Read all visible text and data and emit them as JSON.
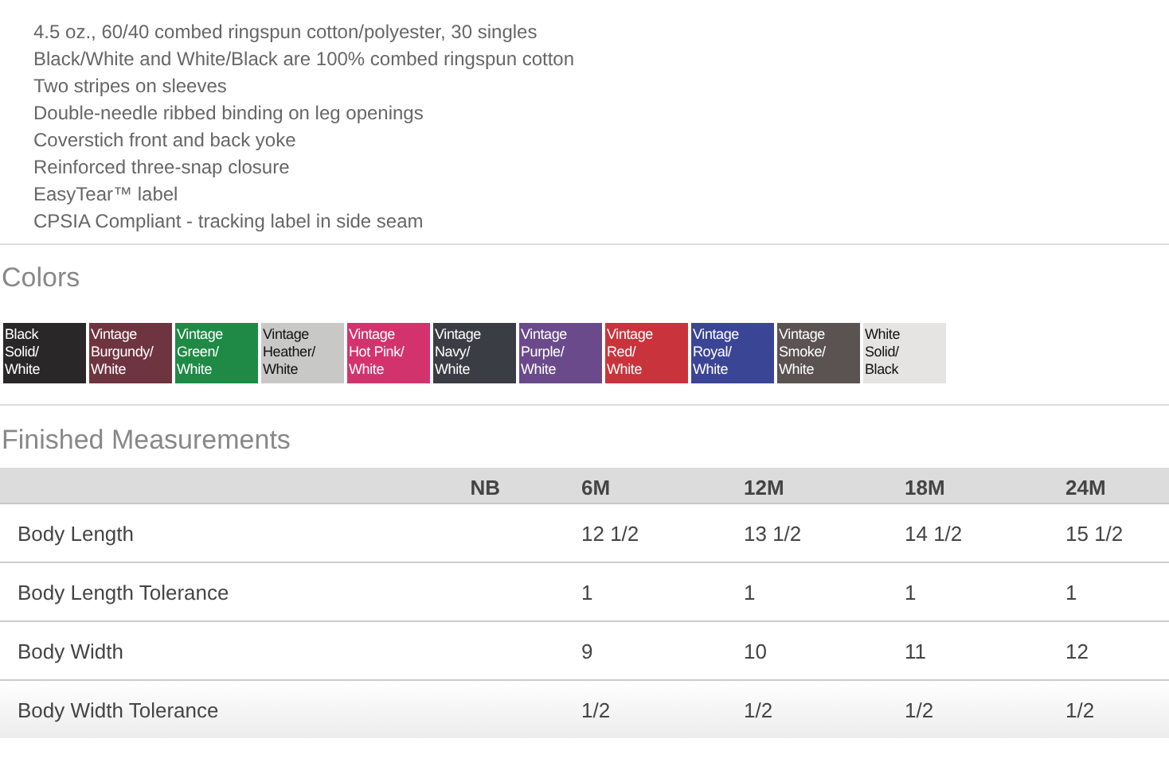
{
  "features": [
    "4.5 oz., 60/40 combed ringspun cotton/polyester, 30 singles",
    "Black/White and White/Black are 100% combed ringspun cotton",
    "Two stripes on sleeves",
    "Double-needle ribbed binding on leg openings",
    "Coverstich front and back yoke",
    "Reinforced three-snap closure",
    "EasyTear™ label",
    "CPSIA Compliant - tracking label in side seam"
  ],
  "colors": {
    "title": "Colors",
    "swatches": [
      {
        "label": "Black\nSolid/\nWhite",
        "color": "#2a2728"
      },
      {
        "label": "Vintage\nBurgundy/\nWhite",
        "color": "#6e3440"
      },
      {
        "label": "Vintage\nGreen/\nWhite",
        "color": "#1f8a45"
      },
      {
        "label": "Vintage\nHeather/\nWhite",
        "color": "#c8c8c6"
      },
      {
        "label": "Vintage\nHot Pink/\nWhite",
        "color": "#d3336d"
      },
      {
        "label": "Vintage\nNavy/\nWhite",
        "color": "#3b3d45"
      },
      {
        "label": "Vintage\nPurple/\nWhite",
        "color": "#6a4a8a"
      },
      {
        "label": "Vintage\nRed/\nWhite",
        "color": "#c9343c"
      },
      {
        "label": "Vintage\nRoyal/\nWhite",
        "color": "#3b4595"
      },
      {
        "label": "Vintage\nSmoke/\nWhite",
        "color": "#5a5352"
      },
      {
        "label": "White\nSolid/\nBlack",
        "color": "#e6e3e3"
      }
    ]
  },
  "measurements": {
    "title": "Finished Measurements",
    "columns": [
      "NB",
      "6M",
      "12M",
      "18M",
      "24M"
    ],
    "rows": [
      {
        "label": "Body Length",
        "values": [
          "12 1/2",
          "13 1/2",
          "14 1/2",
          "15 1/2"
        ]
      },
      {
        "label": "Body Length Tolerance",
        "values": [
          "1",
          "1",
          "1",
          "1"
        ]
      },
      {
        "label": "Body Width",
        "values": [
          "9",
          "10",
          "11",
          "12"
        ]
      },
      {
        "label": "Body Width Tolerance",
        "values": [
          "1/2",
          "1/2",
          "1/2",
          "1/2"
        ]
      }
    ]
  }
}
